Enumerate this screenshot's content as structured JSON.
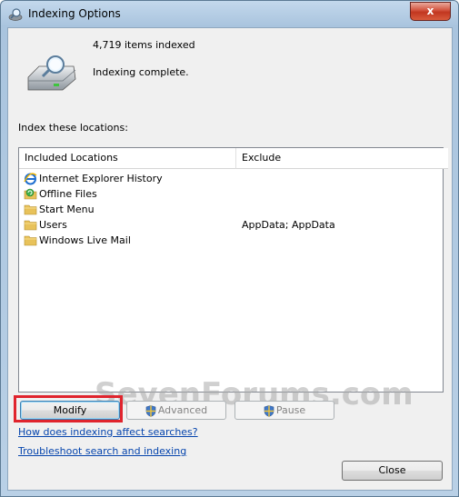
{
  "window": {
    "title": "Indexing Options",
    "close_glyph": "x"
  },
  "summary": {
    "items_indexed": "4,719 items indexed",
    "status": "Indexing complete."
  },
  "locations_label": "Index these locations:",
  "table": {
    "columns": [
      "Included Locations",
      "Exclude"
    ],
    "rows": [
      {
        "label": "Internet Explorer History",
        "exclude": "",
        "icon": "ie-icon"
      },
      {
        "label": "Offline Files",
        "exclude": "",
        "icon": "offline-files-icon"
      },
      {
        "label": "Start Menu",
        "exclude": "",
        "icon": "folder-icon"
      },
      {
        "label": "Users",
        "exclude": "AppData; AppData",
        "icon": "folder-icon"
      },
      {
        "label": "Windows Live Mail",
        "exclude": "",
        "icon": "folder-icon"
      }
    ]
  },
  "buttons": {
    "modify": "Modify",
    "advanced": "Advanced",
    "pause": "Pause",
    "close": "Close"
  },
  "links": {
    "affect": "How does indexing affect searches?",
    "troubleshoot": "Troubleshoot search and indexing"
  },
  "watermark": "SevenForums.com",
  "colors": {
    "highlight": "#e0242d",
    "link": "#0645ad",
    "folder": "#e8c25a"
  }
}
